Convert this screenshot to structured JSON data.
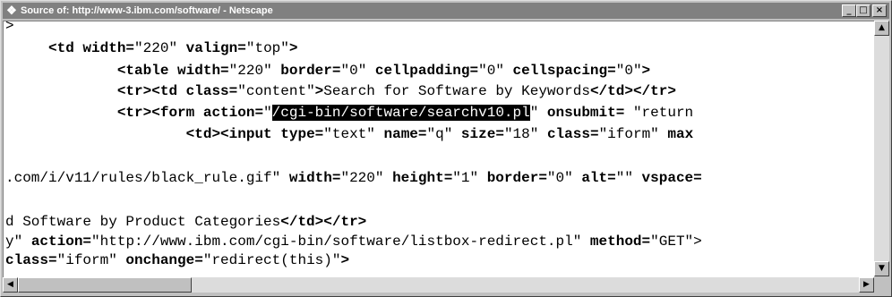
{
  "window": {
    "title": "Source of: http://www-3.ibm.com/software/ - Netscape",
    "icon": "netscape-app-icon",
    "buttons": {
      "minimize": "_",
      "maximize": "□",
      "close": "×"
    }
  },
  "source_lines": [
    [
      {
        "t": ">"
      }
    ],
    [
      {
        "t": "     "
      },
      {
        "t": "<td ",
        "b": true
      },
      {
        "t": "width=",
        "b": true
      },
      {
        "t": "\"220\" "
      },
      {
        "t": "valign=",
        "b": true
      },
      {
        "t": "\"top\""
      },
      {
        "t": ">",
        "b": true
      }
    ],
    [
      {
        "t": "             "
      },
      {
        "t": "<table ",
        "b": true
      },
      {
        "t": "width=",
        "b": true
      },
      {
        "t": "\"220\" "
      },
      {
        "t": "border=",
        "b": true
      },
      {
        "t": "\"0\" "
      },
      {
        "t": "cellpadding=",
        "b": true
      },
      {
        "t": "\"0\" "
      },
      {
        "t": "cellspacing=",
        "b": true
      },
      {
        "t": "\"0\""
      },
      {
        "t": ">",
        "b": true
      }
    ],
    [
      {
        "t": "             "
      },
      {
        "t": "<tr><td ",
        "b": true
      },
      {
        "t": "class=",
        "b": true
      },
      {
        "t": "\"content\""
      },
      {
        "t": ">",
        "b": true
      },
      {
        "t": "Search for Software by Keywords"
      },
      {
        "t": "</td></tr>",
        "b": true
      }
    ],
    [
      {
        "t": "             "
      },
      {
        "t": "<tr><form ",
        "b": true
      },
      {
        "t": "action=",
        "b": true
      },
      {
        "t": "\""
      },
      {
        "t": "/cgi-bin/software/searchv10.pl",
        "h": true
      },
      {
        "t": "\" "
      },
      {
        "t": "onsubmit=",
        "b": true
      },
      {
        "t": " \"return"
      }
    ],
    [
      {
        "t": "                     "
      },
      {
        "t": "<td><input ",
        "b": true
      },
      {
        "t": "type=",
        "b": true
      },
      {
        "t": "\"text\" "
      },
      {
        "t": "name=",
        "b": true
      },
      {
        "t": "\"q\" "
      },
      {
        "t": "size=",
        "b": true
      },
      {
        "t": "\"18\" "
      },
      {
        "t": "class=",
        "b": true
      },
      {
        "t": "\"iform\" "
      },
      {
        "t": "max",
        "b": true
      }
    ],
    [],
    [
      {
        "t": ".com/i/v11/rules/black_rule.gif\" "
      },
      {
        "t": "width=",
        "b": true
      },
      {
        "t": "\"220\" "
      },
      {
        "t": "height=",
        "b": true
      },
      {
        "t": "\"1\" "
      },
      {
        "t": "border=",
        "b": true
      },
      {
        "t": "\"0\" "
      },
      {
        "t": "alt=",
        "b": true
      },
      {
        "t": "\"\" "
      },
      {
        "t": "vspace=",
        "b": true
      }
    ],
    [],
    [
      {
        "t": "d Software by Product Categories"
      },
      {
        "t": "</td></tr>",
        "b": true
      }
    ],
    [
      {
        "t": "y\" "
      },
      {
        "t": "action=",
        "b": true
      },
      {
        "t": "\"http://www.ibm.com/cgi-bin/software/listbox-redirect.pl\" "
      },
      {
        "t": "method=",
        "b": true
      },
      {
        "t": "\"GET\">",
        "b": false
      }
    ],
    [
      {
        "t": "class=",
        "b": true
      },
      {
        "t": "\"iform\" "
      },
      {
        "t": "onchange=",
        "b": true
      },
      {
        "t": "\"redirect(this)\""
      },
      {
        "t": ">",
        "b": true
      }
    ]
  ],
  "scrollbars": {
    "vertical": {
      "up_arrow": "▲",
      "down_arrow": "▼"
    },
    "horizontal": {
      "left_arrow": "◀",
      "right_arrow": "▶"
    }
  }
}
